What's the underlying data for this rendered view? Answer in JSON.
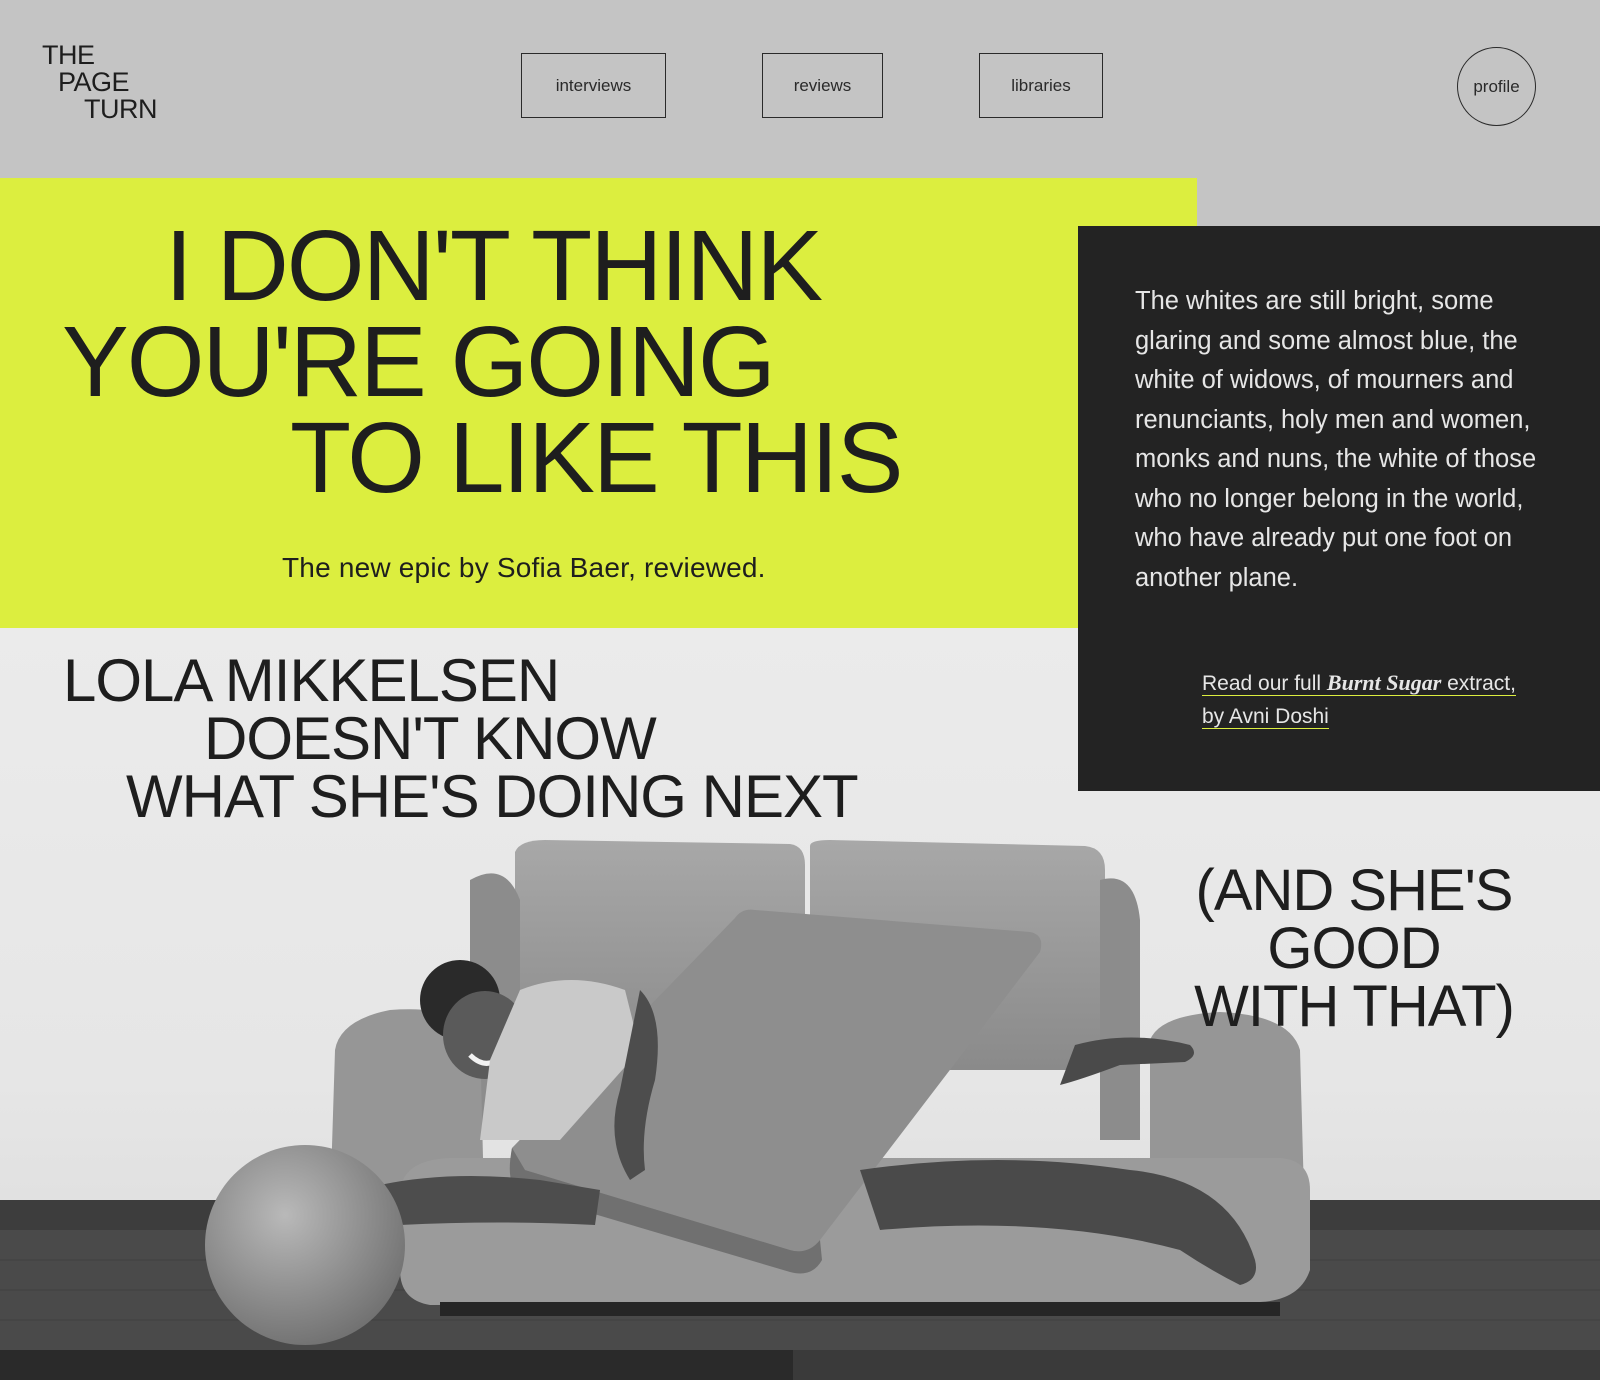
{
  "brand": {
    "logo_line1": "THE",
    "logo_line2": "PAGE",
    "logo_line3": "TURN"
  },
  "nav": {
    "interviews": "interviews",
    "reviews": "reviews",
    "libraries": "libraries",
    "profile": "profile"
  },
  "hero": {
    "headline_line1": "I DON'T THINK",
    "headline_line2": "YOU'RE GOING",
    "headline_line3": "TO LIKE THIS",
    "subtitle": "The new epic by Sofia Baer, reviewed."
  },
  "extract": {
    "quote": "The whites are still bright, some glaring and some almost blue, the white of widows, of mourners and renunciants, holy men and women, monks and nuns, the white of those who no longer belong in the world, who have already put one foot on another plane.",
    "link_prefix": "Read our full ",
    "link_title": "Burnt Sugar",
    "link_suffix": " extract,",
    "link_line2": "by Avni Doshi"
  },
  "feature": {
    "headline_line1": "LOLA MIKKELSEN",
    "headline_line2": "DOESN'T KNOW",
    "headline_line3": "WHAT SHE'S DOING NEXT",
    "aside_line1": "(AND SHE'S",
    "aside_line2": "GOOD",
    "aside_line3": "WITH THAT)"
  },
  "colors": {
    "accent_lime": "#dcee3f",
    "dark_panel": "#232323",
    "header_gray": "#c4c4c4"
  }
}
